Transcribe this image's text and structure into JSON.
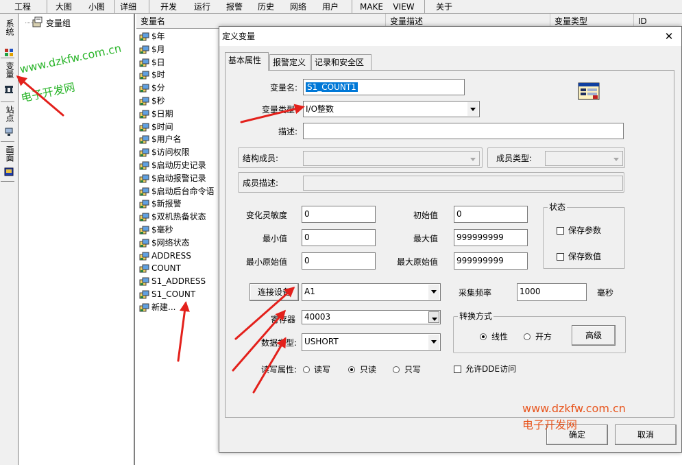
{
  "menu": {
    "items": [
      "工程",
      "大图",
      "小图",
      "详细",
      "开发",
      "运行",
      "报警",
      "历史",
      "网络",
      "用户",
      "MAKE",
      "VIEW",
      "关于"
    ]
  },
  "side_tabs": [
    "系统",
    "变量",
    "站点",
    "画面"
  ],
  "tree": {
    "root": "变量组"
  },
  "list": {
    "columns": [
      "变量名",
      "变量描述",
      "变量类型",
      "ID"
    ],
    "rows": [
      "$年",
      "$月",
      "$日",
      "$时",
      "$分",
      "$秒",
      "$日期",
      "$时间",
      "$用户名",
      "$访问权限",
      "$启动历史记录",
      "$启动报警记录",
      "$启动后台命令语",
      "$新报警",
      "$双机热备状态",
      "$毫秒",
      "$网络状态",
      "ADDRESS",
      "COUNT",
      "S1_ADDRESS",
      "S1_COUNT",
      "新建..."
    ]
  },
  "dialog": {
    "title": "定义变量",
    "close": "✕",
    "tabs": [
      "基本属性",
      "报警定义",
      "记录和安全区"
    ],
    "labels": {
      "var_name": "变量名:",
      "var_type": "变量类型:",
      "desc": "描述:",
      "struct_member": "结构成员:",
      "member_type": "成员类型:",
      "member_desc": "成员描述:",
      "sensitivity": "变化灵敏度",
      "initial": "初始值",
      "min": "最小值",
      "max": "最大值",
      "min_raw": "最小原始值",
      "max_raw": "最大原始值",
      "status_group": "状态",
      "save_params": "保存参数",
      "save_values": "保存数值",
      "device_btn": "连接设备",
      "sample_rate": "采集频率",
      "ms": "毫秒",
      "register": "寄存器",
      "data_type": "数据类型:",
      "convert_group": "转换方式",
      "linear": "线性",
      "sqrt": "开方",
      "advanced": "高级",
      "rw": "读写属性:",
      "read_write": "读写",
      "read_only": "只读",
      "write_only": "只写",
      "dde": "允许DDE访问",
      "ok": "确定",
      "cancel": "取消"
    },
    "values": {
      "var_name": "S1_COUNT1",
      "var_type": "I/O整数",
      "desc": "",
      "sensitivity": "0",
      "initial": "0",
      "min": "0",
      "max": "999999999",
      "min_raw": "0",
      "max_raw": "999999999",
      "device": "A1",
      "sample_rate": "1000",
      "register": "40003",
      "data_type": "USHORT"
    },
    "state": {
      "save_params": false,
      "save_values": false,
      "conversion": "线性",
      "access": "只读",
      "dde": false
    }
  },
  "watermarks": {
    "url": "www.dzkfw.com.cn",
    "name": "电子开发网"
  },
  "colors": {
    "watermark_green": "#2bb52b",
    "watermark_orange": "#e8541c",
    "annotation_red": "#e3201b",
    "selection": "#0078d7"
  }
}
